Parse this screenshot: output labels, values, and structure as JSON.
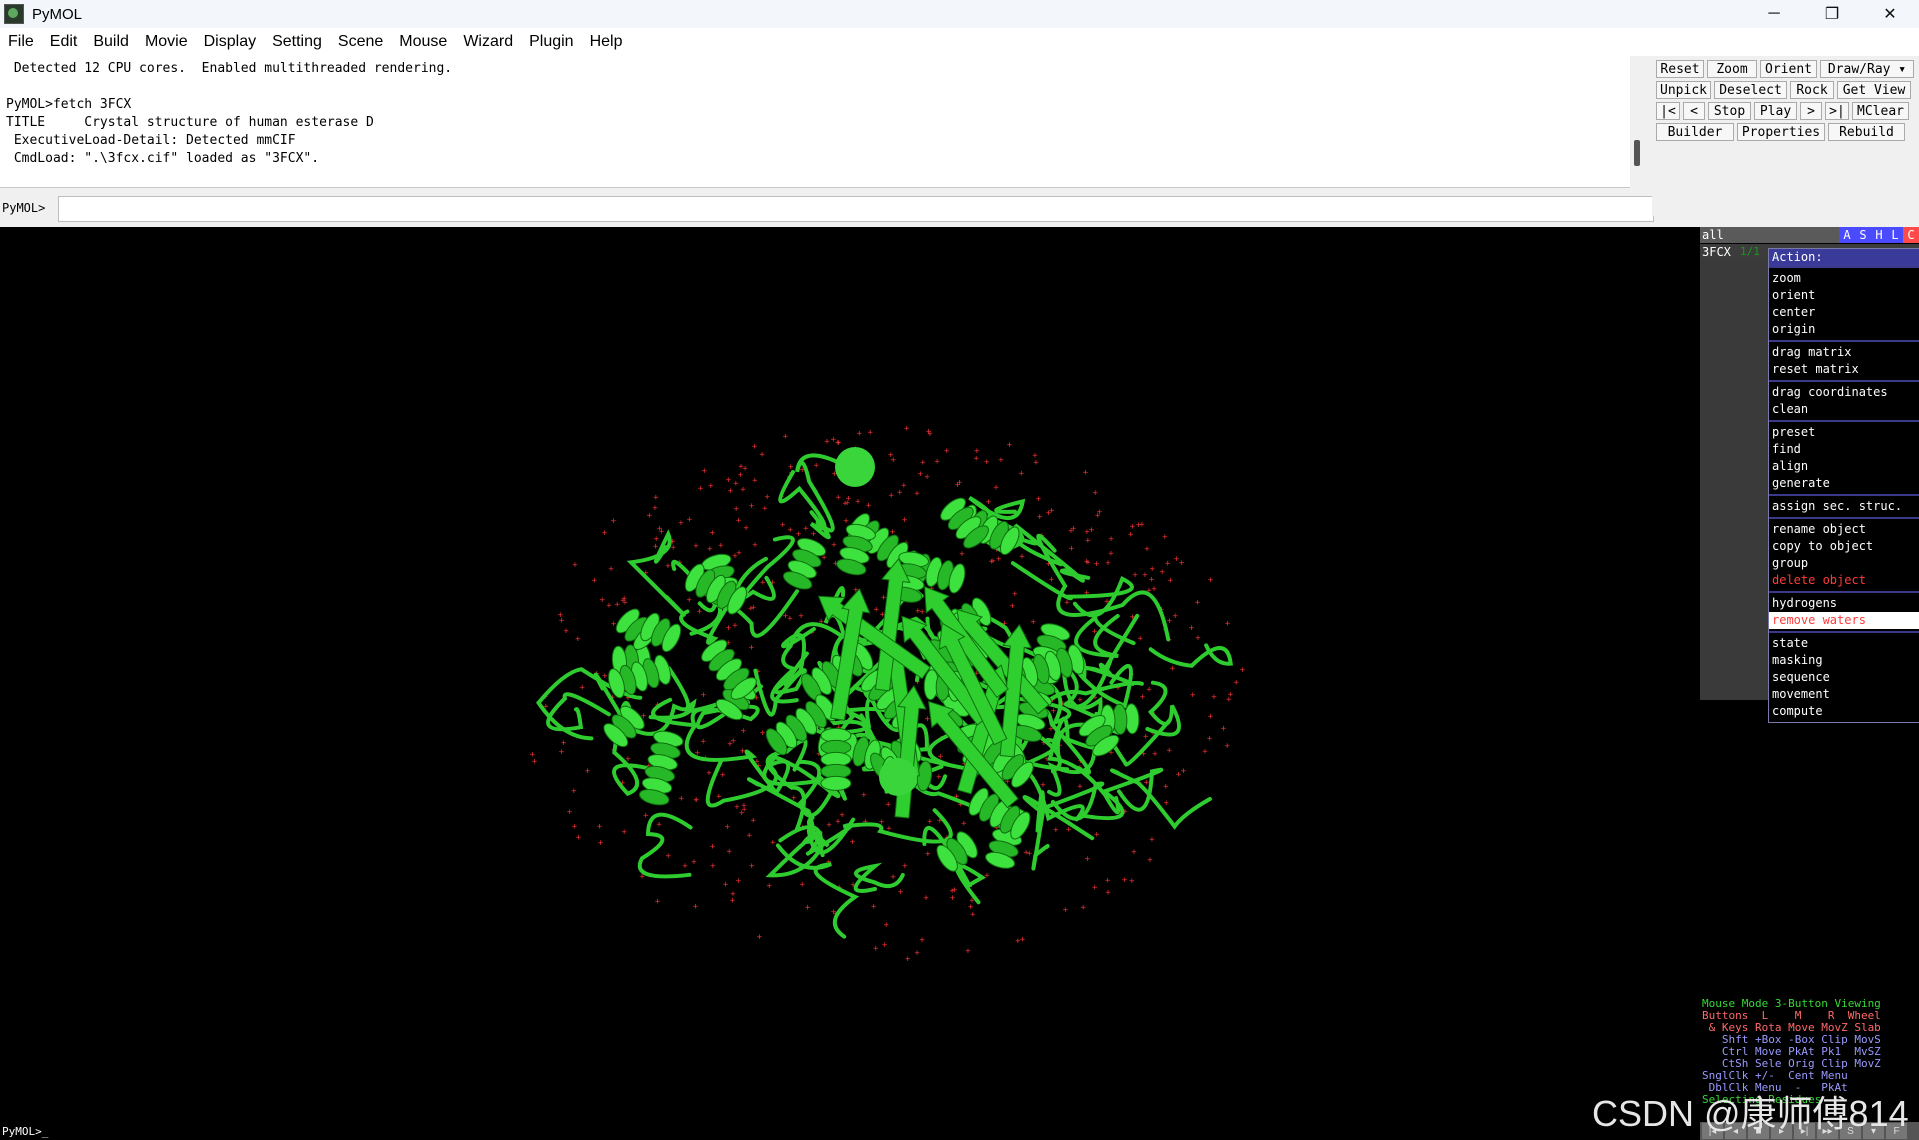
{
  "window": {
    "title": "PyMOL",
    "minimize": "─",
    "maximize": "❐",
    "close": "✕"
  },
  "menu": [
    "File",
    "Edit",
    "Build",
    "Movie",
    "Display",
    "Setting",
    "Scene",
    "Mouse",
    "Wizard",
    "Plugin",
    "Help"
  ],
  "output": {
    "lines": [
      " Detected 12 CPU cores.  Enabled multithreaded rendering.",
      "",
      "PyMOL>fetch 3FCX",
      "TITLE     Crystal structure of human esterase D",
      " ExecutiveLoad-Detail: Detected mmCIF",
      " CmdLoad: \".\\3fcx.cif\" loaded as \"3FCX\"."
    ]
  },
  "command": {
    "prompt": "PyMOL>",
    "value": ""
  },
  "buttons": {
    "row1": [
      "Reset",
      "Zoom",
      "Orient",
      "Draw/Ray ▾"
    ],
    "row2": [
      "Unpick",
      "Deselect",
      "Rock",
      "Get View"
    ],
    "row3": [
      "|<",
      "<",
      "Stop",
      "Play",
      ">",
      ">|",
      "MClear"
    ],
    "row4": [
      "Builder",
      "Properties",
      "Rebuild"
    ]
  },
  "objects": {
    "all_label": "all",
    "ashlc": [
      "A",
      "S",
      "H",
      "L",
      "C"
    ],
    "ashlc_colors": [
      "#4a4aff",
      "#4a4aff",
      "#4a4aff",
      "#4a4aff",
      "#ff4a4a"
    ],
    "items": [
      {
        "name": "3FCX",
        "state": "1/1"
      }
    ]
  },
  "action_menu": {
    "title": "Action:",
    "groups": [
      [
        "zoom",
        "orient",
        "center",
        "origin"
      ],
      [
        "drag matrix",
        "reset matrix"
      ],
      [
        "drag coordinates",
        "clean"
      ],
      [
        "preset",
        "find",
        "align",
        "generate"
      ],
      [
        "assign sec. struc."
      ],
      [
        "rename object",
        "copy to object",
        "group",
        "delete object"
      ],
      [
        "hydrogens",
        "remove waters"
      ],
      [
        "state",
        "masking",
        "sequence",
        "movement",
        "compute"
      ]
    ],
    "red_items": [
      "delete object"
    ],
    "highlighted": "remove waters"
  },
  "mouse_mode": {
    "lines": [
      "Mouse Mode 3-Button Viewing",
      "Buttons  L    M    R  Wheel",
      " & Keys Rota Move MovZ Slab",
      "   Shft +Box -Box Clip MovS",
      "   Ctrl Move PkAt Pk1  MvSZ",
      "   CtSh Sele Orig Clip MovZ",
      "SnglClk +/-  Cent Menu",
      " DblClk Menu  -   PkAt",
      "Selecting Residues"
    ]
  },
  "playback": [
    "|◂",
    "◂",
    "■",
    "▸",
    "▸|",
    "▸▸",
    "S",
    "▾",
    "F"
  ],
  "bottom_prompt": "PyMOL>_",
  "watermark": "CSDN @康师傅814",
  "colors": {
    "protein": "#2ecc2e",
    "water": "#e03030",
    "ion": "#3ad53a"
  }
}
